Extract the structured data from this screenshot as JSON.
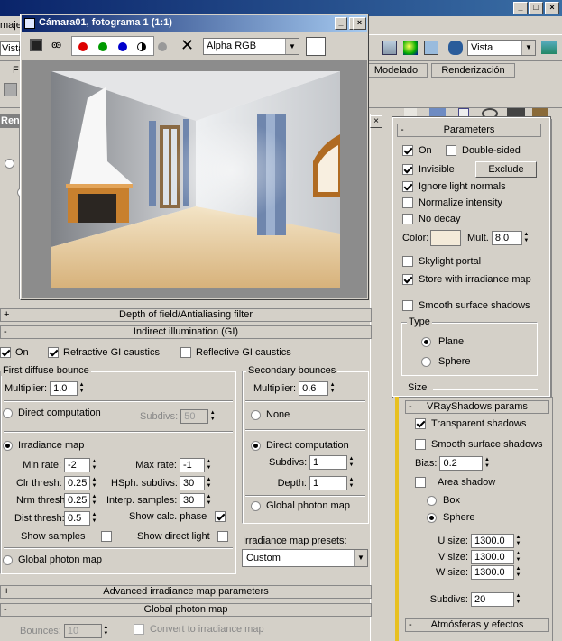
{
  "menu": {
    "partial_label": "maje",
    "view_label": "Vista"
  },
  "toolbar": {
    "view_select": "Vista",
    "tab_model": "Modelado",
    "tab_render": "Renderización",
    "left_partial": "Ren",
    "f_partial": "F"
  },
  "render_window": {
    "title": "Cámara01, fotograma 1 (1:1)",
    "channel_select": "Alpha RGB"
  },
  "rollups": {
    "dof": "Depth of field/Antialiasing filter",
    "gi": "Indirect illumination (GI)",
    "adv_irr": "Advanced irradiance map parameters",
    "photon": "Global photon map"
  },
  "gi": {
    "on_label": "On",
    "refractive_label": "Refractive GI caustics",
    "reflective_label": "Reflective GI caustics",
    "first_bounce": {
      "title": "First diffuse bounce",
      "multiplier_label": "Multiplier:",
      "multiplier": "1.0",
      "direct_label": "Direct computation",
      "subdivs_label": "Subdivs:",
      "subdivs": "50",
      "irradiance_label": "Irradiance map",
      "min_rate_label": "Min rate:",
      "min_rate": "-2",
      "max_rate_label": "Max rate:",
      "max_rate": "-1",
      "clr_label": "Clr thresh:",
      "clr": "0.25",
      "hsph_label": "HSph. subdivs:",
      "hsph": "30",
      "nrm_label": "Nrm thresh:",
      "nrm": "0.25",
      "interp_label": "Interp. samples:",
      "interp": "30",
      "dist_label": "Dist thresh:",
      "dist": "0.5",
      "show_calc_label": "Show calc. phase",
      "show_samples_label": "Show samples",
      "show_direct_label": "Show direct light",
      "photon_label": "Global photon map"
    },
    "secondary": {
      "title": "Secondary bounces",
      "multiplier_label": "Multiplier:",
      "multiplier": "0.6",
      "none_label": "None",
      "direct_label": "Direct computation",
      "subdivs_label": "Subdivs:",
      "subdivs": "1",
      "depth_label": "Depth:",
      "depth": "1",
      "photon_label": "Global photon map"
    },
    "presets_label": "Irradiance map presets:",
    "presets_value": "Custom"
  },
  "photon_map": {
    "bounces_label": "Bounces:",
    "bounces": "10",
    "convert_label": "Convert to irradiance map"
  },
  "light_params": {
    "title": "Parameters",
    "on_label": "On",
    "double_sided_label": "Double-sided",
    "invisible_label": "Invisible",
    "exclude_label": "Exclude",
    "ignore_normals_label": "Ignore light normals",
    "normalize_label": "Normalize intensity",
    "no_decay_label": "No decay",
    "color_label": "Color:",
    "mult_label": "Mult.",
    "mult": "8.0",
    "skylight_label": "Skylight portal",
    "store_irr_label": "Store with irradiance map",
    "smooth_label": "Smooth surface shadows",
    "type_title": "Type",
    "plane_label": "Plane",
    "sphere_label": "Sphere",
    "size_title": "Size",
    "light_color": "#f3ead9"
  },
  "shadows": {
    "title": "VRayShadows params",
    "transparent_label": "Transparent shadows",
    "smooth_label": "Smooth surface shadows",
    "bias_label": "Bias:",
    "bias": "0.2",
    "area_label": "Area shadow",
    "box_label": "Box",
    "sphere_label": "Sphere",
    "u_label": "U size:",
    "u": "1300.0",
    "v_label": "V size:",
    "v": "1300.0",
    "w_label": "W size:",
    "w": "1300.0",
    "subdivs_label": "Subdivs:",
    "subdivs": "20"
  },
  "atmos": {
    "title": "Atmósferas y efectos"
  }
}
